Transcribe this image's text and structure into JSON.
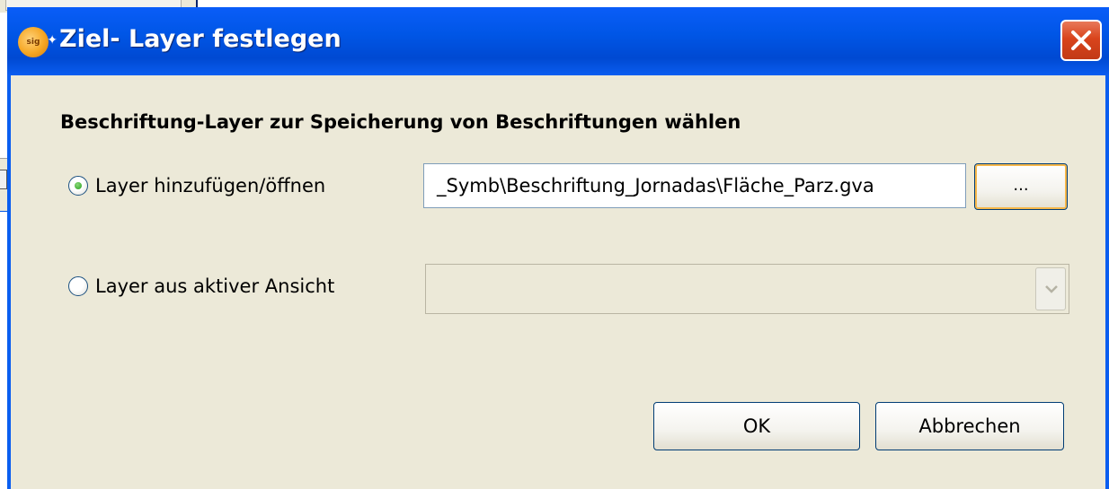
{
  "dialog": {
    "title": "Ziel- Layer festlegen",
    "app_icon": "gvsig-sun-icon",
    "close_icon": "close-x-icon"
  },
  "content": {
    "heading": "Beschriftung-Layer zur Speicherung von Beschriftungen wählen",
    "option_add": {
      "label": "Layer hinzufügen/öffnen",
      "selected": true
    },
    "path_value": "_Symb\\Beschriftung_Jornadas\\Fläche_Parz.gva",
    "browse_label": "...",
    "option_active_view": {
      "label": "Layer aus aktiver Ansicht",
      "selected": false
    },
    "layer_select_value": ""
  },
  "buttons": {
    "ok": "OK",
    "cancel": "Abbrechen"
  },
  "colors": {
    "titlebar": "#0058e6",
    "dialog_bg": "#ece9d8",
    "close_button": "#d9441c",
    "radio_selected": "#27a11b"
  }
}
